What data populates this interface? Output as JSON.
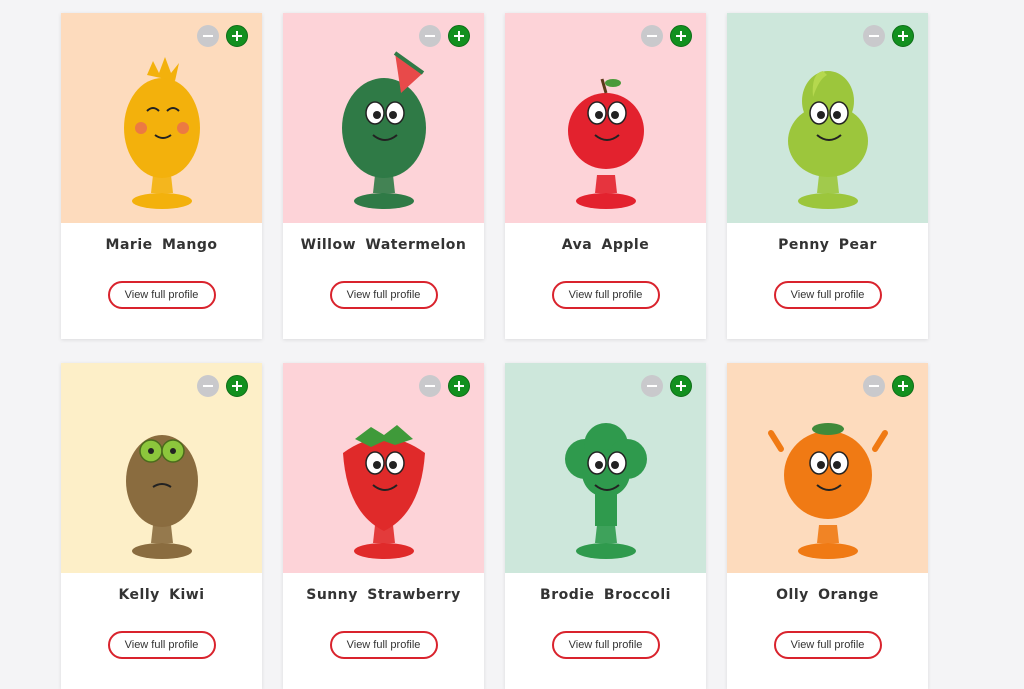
{
  "characters": [
    {
      "name": "Marie Mango",
      "button": "View full profile",
      "bg": "#fddbbd",
      "body": "#f3b10c",
      "kind": "mango"
    },
    {
      "name": "Willow Watermelon",
      "button": "View full profile",
      "bg": "#fdd3d8",
      "body": "#2f7a46",
      "kind": "watermelon"
    },
    {
      "name": "Ava Apple",
      "button": "View full profile",
      "bg": "#fdd3d8",
      "body": "#e3222e",
      "kind": "apple"
    },
    {
      "name": "Penny Pear",
      "button": "View full profile",
      "bg": "#cde7db",
      "body": "#9cc63c",
      "kind": "pear"
    },
    {
      "name": "Kelly Kiwi",
      "button": "View full profile",
      "bg": "#fdefc8",
      "body": "#8a6c3f",
      "kind": "kiwi"
    },
    {
      "name": "Sunny Strawberry",
      "button": "View full profile",
      "bg": "#fdd3d8",
      "body": "#e02a2a",
      "kind": "strawberry"
    },
    {
      "name": "Brodie Broccoli",
      "button": "View full profile",
      "bg": "#cde7db",
      "body": "#2f9a4d",
      "kind": "broccoli"
    },
    {
      "name": "Olly Orange",
      "button": "View full profile",
      "bg": "#fddbbd",
      "body": "#f07a14",
      "kind": "orange"
    }
  ],
  "colors": {
    "accent_red": "#d9232d",
    "plus_green": "#12901f",
    "minus_grey": "#c9c9cc"
  },
  "icons": {
    "minus": "minus-circle-icon",
    "plus": "plus-circle-icon"
  }
}
